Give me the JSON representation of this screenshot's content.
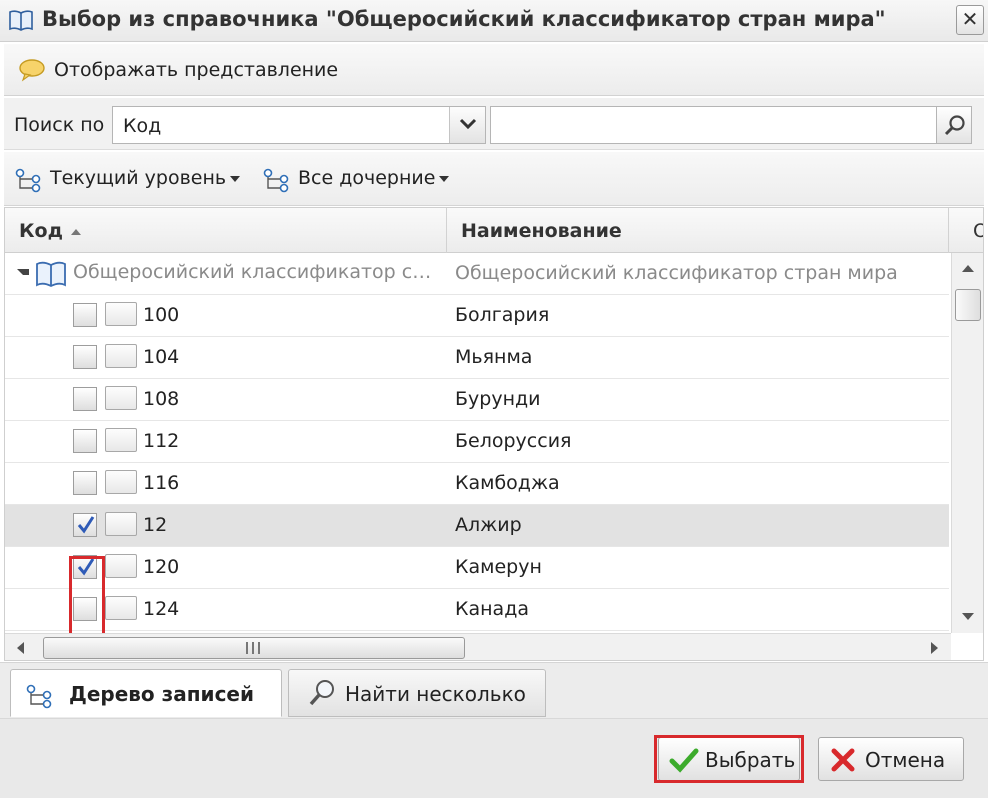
{
  "window": {
    "title": "Выбор из справочника \"Общеросийский классификатор стран мира\"",
    "close_label": "✕"
  },
  "toolbar": {
    "view_label": "Отображать представление"
  },
  "search": {
    "label": "Поиск по",
    "field_value": "Код",
    "input_value": ""
  },
  "tree_toolbar": {
    "current_level_label": "Текущий уровень",
    "all_children_label": "Все дочерние"
  },
  "grid": {
    "columns": [
      {
        "label": "Код",
        "sort": "asc"
      },
      {
        "label": "Наименование"
      },
      {
        "label": "О"
      }
    ],
    "root": {
      "code": "Общеросийский классификатор стран мира",
      "name": "Общеросийский классификатор стран мира"
    },
    "rows": [
      {
        "code": "100",
        "name": "Болгария",
        "checked": false
      },
      {
        "code": "104",
        "name": "Мьянма",
        "checked": false
      },
      {
        "code": "108",
        "name": "Бурунди",
        "checked": false
      },
      {
        "code": "112",
        "name": "Белоруссия",
        "checked": false
      },
      {
        "code": "116",
        "name": "Камбоджа",
        "checked": false
      },
      {
        "code": "12",
        "name": "Алжир",
        "checked": true
      },
      {
        "code": "120",
        "name": "Камерун",
        "checked": true
      },
      {
        "code": "124",
        "name": "Канада",
        "checked": false
      }
    ],
    "hscroll_grip": "III"
  },
  "tabs": [
    {
      "label": "Дерево записей",
      "active": true
    },
    {
      "label": "Найти несколько",
      "active": false
    }
  ],
  "footer": {
    "select_label": "Выбрать",
    "cancel_label": "Отмена"
  },
  "colors": {
    "highlight": "#d8292c",
    "checkmark": "#2f5bb7",
    "ok_icon": "#3cab2c",
    "cancel_icon": "#d8292c"
  }
}
